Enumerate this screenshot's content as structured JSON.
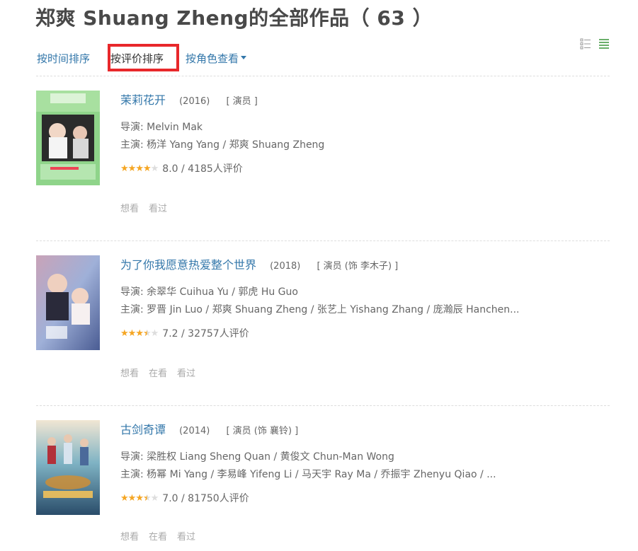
{
  "header": {
    "title": "郑爽 Shuang Zheng的全部作品（ 63 ）"
  },
  "sort": {
    "by_time": "按时间排序",
    "by_rating": "按评价排序",
    "by_role": "按角色查看"
  },
  "view": {
    "list_icon": "list-view-icon",
    "grid_icon": "compact-list-view-icon",
    "active_color": "#6aaf6a"
  },
  "items": [
    {
      "title": "茉莉花开",
      "year": "(2016)",
      "role": "[ 演员 ]",
      "director": "导演: Melvin Mak",
      "cast": "主演: 杨洋 Yang Yang / 郑爽 Shuang Zheng",
      "rating": 8.0,
      "rating_text": "8.0 / 4185人评价",
      "stars": [
        1,
        1,
        1,
        1,
        0
      ],
      "actions": [
        "想看",
        "看过"
      ]
    },
    {
      "title": "为了你我愿意热爱整个世界",
      "year": "(2018)",
      "role": "[ 演员 (饰 李木子) ]",
      "director": "导演: 余翠华 Cuihua Yu / 郭虎 Hu Guo",
      "cast": "主演: 罗晋 Jin Luo / 郑爽 Shuang Zheng / 张艺上 Yishang Zhang / 庞瀚辰 Hanchen...",
      "rating": 7.2,
      "rating_text": "7.2 / 32757人评价",
      "stars": [
        1,
        1,
        1,
        0.5,
        0
      ],
      "actions": [
        "想看",
        "在看",
        "看过"
      ]
    },
    {
      "title": "古剑奇谭",
      "year": "(2014)",
      "role": "[ 演员 (饰 襄铃) ]",
      "director": "导演: 梁胜权 Liang Sheng Quan / 黄俊文 Chun-Man Wong",
      "cast": "主演: 杨幂 Mi Yang / 李易峰 Yifeng Li / 马天宇 Ray Ma / 乔振宇 Zhenyu Qiao / ...",
      "rating": 7.0,
      "rating_text": "7.0 / 81750人评价",
      "stars": [
        1,
        1,
        1,
        0.5,
        0
      ],
      "actions": [
        "想看",
        "在看",
        "看过"
      ]
    }
  ]
}
